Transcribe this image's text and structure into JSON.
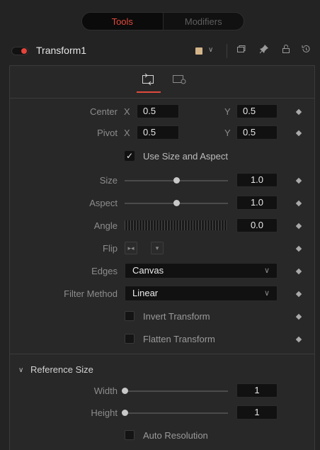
{
  "tabs": {
    "tools": "Tools",
    "modifiers": "Modifiers"
  },
  "header": {
    "node_name": "Transform1",
    "swatch_color": "#d4b58a",
    "dropdown_glyph": "∨"
  },
  "controls": {
    "center": {
      "label": "Center",
      "x_label": "X",
      "x_value": "0.5",
      "y_label": "Y",
      "y_value": "0.5"
    },
    "pivot": {
      "label": "Pivot",
      "x_label": "X",
      "x_value": "0.5",
      "y_label": "Y",
      "y_value": "0.5"
    },
    "use_size_aspect": {
      "label": "Use Size and Aspect",
      "checked": true
    },
    "size": {
      "label": "Size",
      "value": "1.0",
      "level": 0.5
    },
    "aspect": {
      "label": "Aspect",
      "value": "1.0",
      "level": 0.5
    },
    "angle": {
      "label": "Angle",
      "value": "0.0"
    },
    "flip": {
      "label": "Flip"
    },
    "edges": {
      "label": "Edges",
      "value": "Canvas"
    },
    "filter_method": {
      "label": "Filter Method",
      "value": "Linear"
    },
    "invert_transform": {
      "label": "Invert Transform",
      "checked": false
    },
    "flatten_transform": {
      "label": "Flatten Transform",
      "checked": false
    }
  },
  "reference_size": {
    "title": "Reference Size",
    "width": {
      "label": "Width",
      "value": "1",
      "level": 0.0
    },
    "height": {
      "label": "Height",
      "value": "1",
      "level": 0.0
    },
    "auto_resolution": {
      "label": "Auto Resolution",
      "checked": false
    }
  },
  "colors": {
    "accent": "#e04a3c",
    "toggle_dot": "#e5443b"
  }
}
